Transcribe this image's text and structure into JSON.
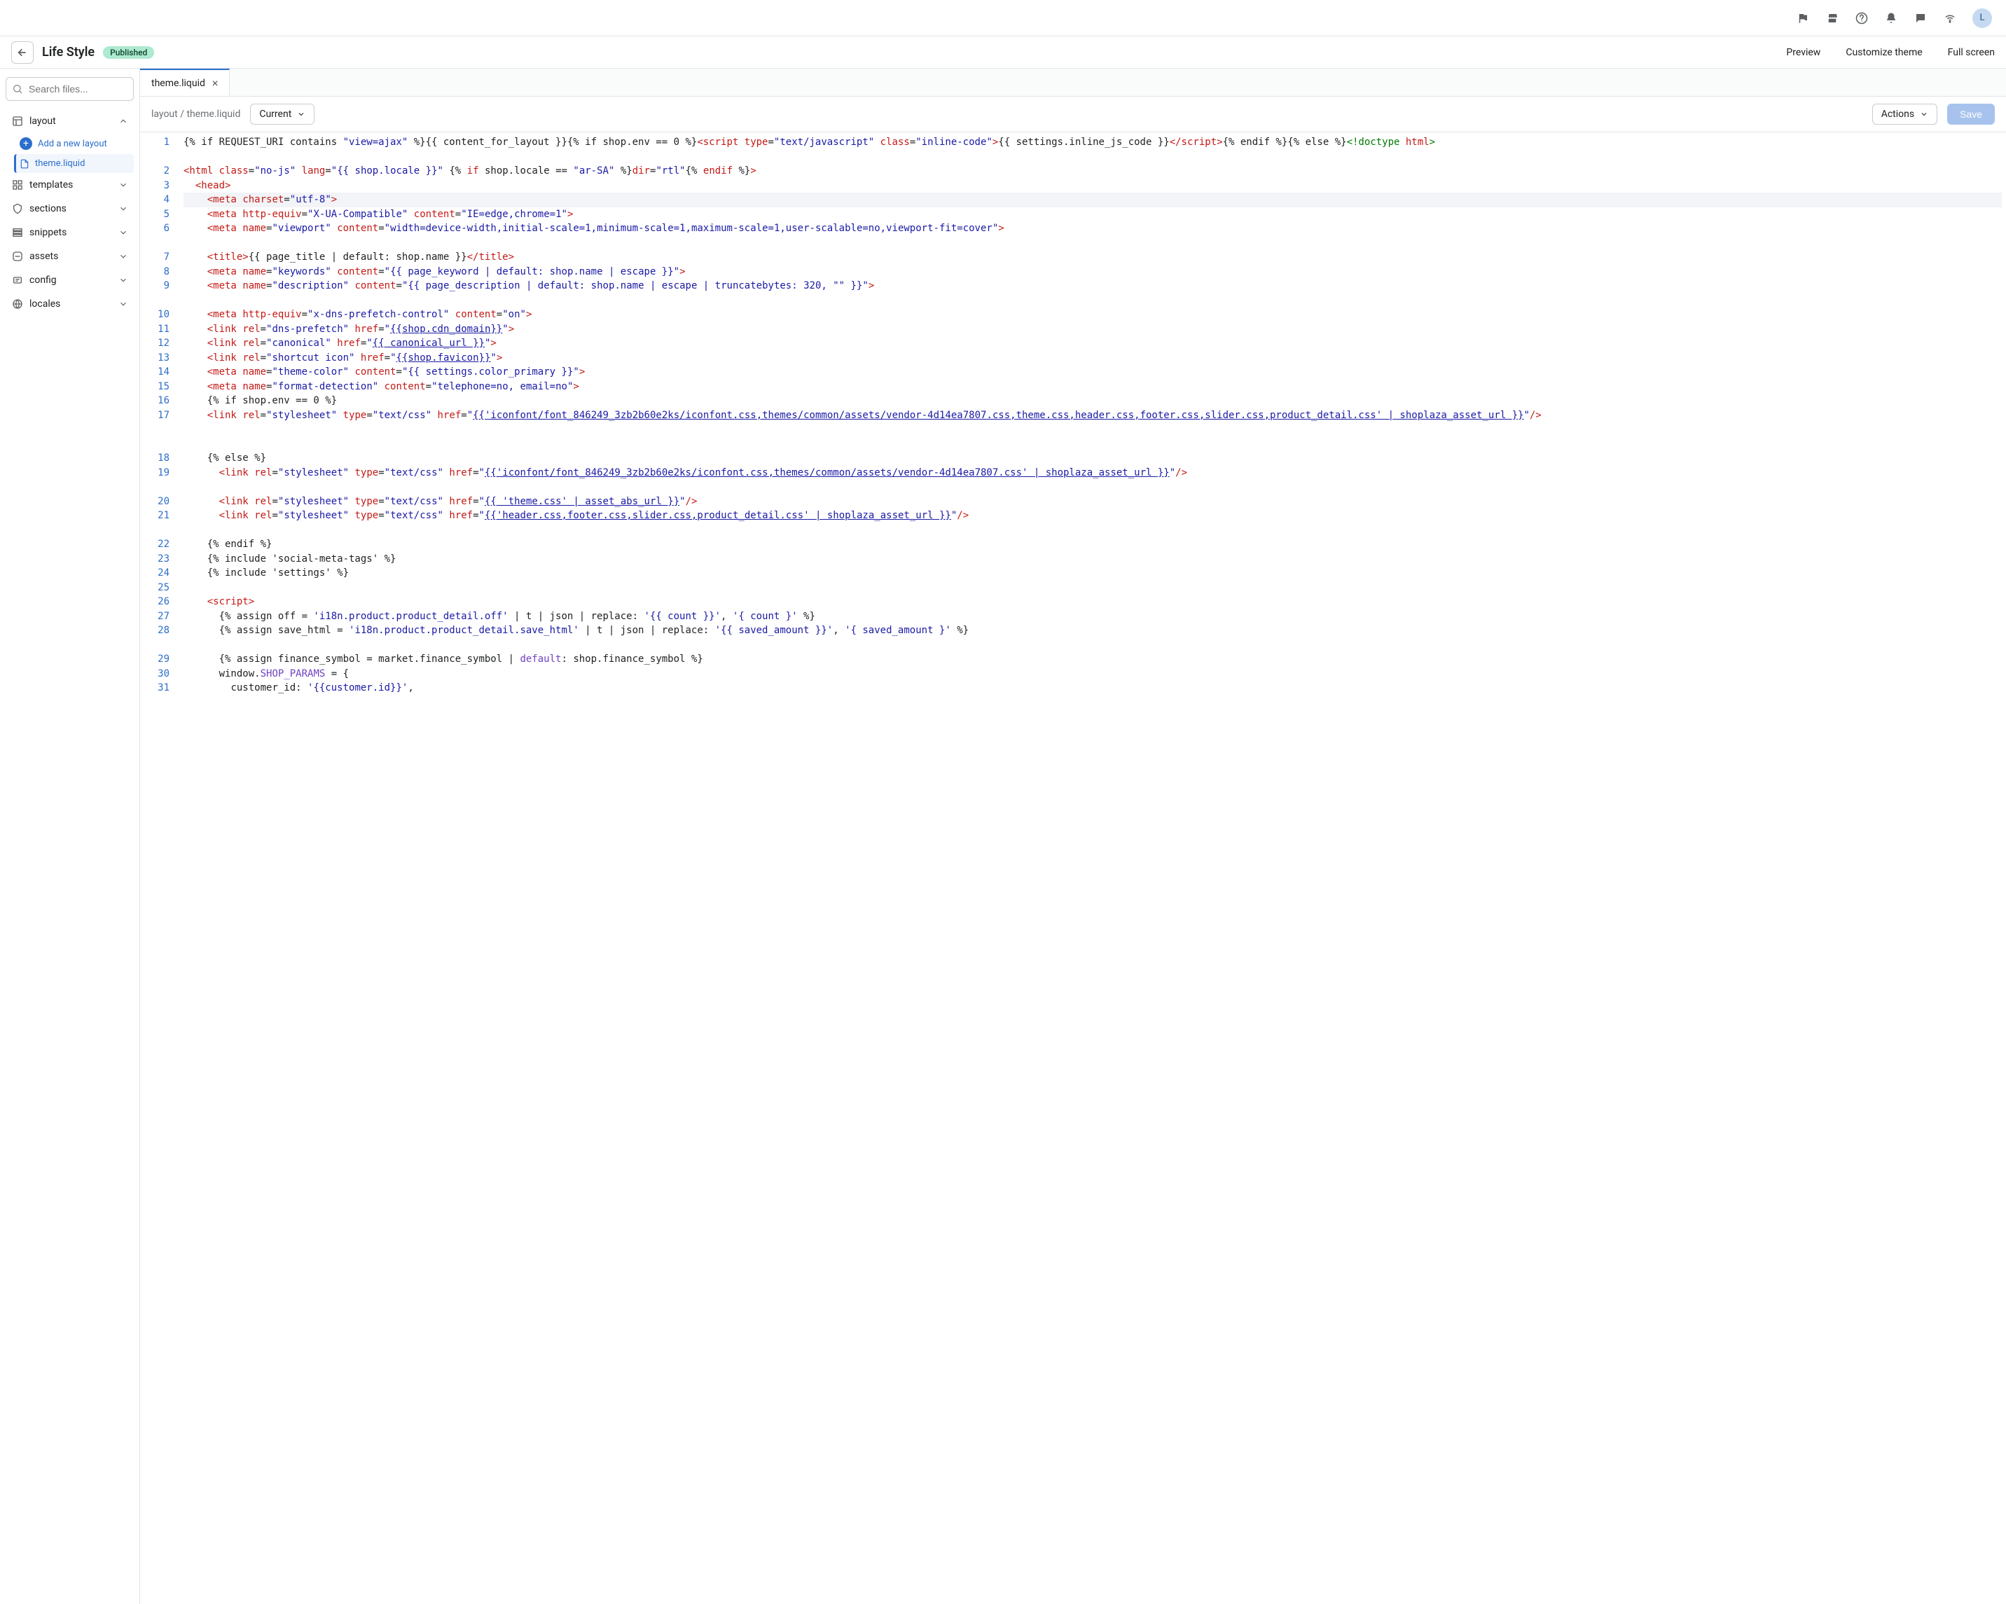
{
  "topbar": {
    "avatar_initial": "L"
  },
  "header": {
    "title": "Life Style",
    "badge": "Published",
    "preview": "Preview",
    "customize": "Customize theme",
    "fullscreen": "Full screen"
  },
  "sidebar": {
    "search_placeholder": "Search files...",
    "sections": [
      {
        "label": "layout",
        "expanded": true
      },
      {
        "label": "templates",
        "expanded": false
      },
      {
        "label": "sections",
        "expanded": false
      },
      {
        "label": "snippets",
        "expanded": false
      },
      {
        "label": "assets",
        "expanded": false
      },
      {
        "label": "config",
        "expanded": false
      },
      {
        "label": "locales",
        "expanded": false
      }
    ],
    "add_layout": "Add a new layout",
    "active_file": "theme.liquid"
  },
  "tabs": {
    "active": "theme.liquid"
  },
  "toolbar": {
    "breadcrumb": "layout / theme.liquid",
    "version": "Current",
    "actions": "Actions",
    "save": "Save"
  },
  "code": {
    "lines": [
      {
        "n": 1,
        "wrap": 2,
        "html": "{% if REQUEST_URI contains <span class='t-str'>\"view=ajax\"</span> %}{{ content_for_layout }}{% if shop.env == 0 %}<span class='t-tag'>&lt;script</span> <span class='t-attr'>type</span>=<span class='t-str'>\"text/javascript\"</span> <span class='t-attr'>class</span>=<span class='t-str'>\"inline-code\"</span><span class='t-tag'>&gt;</span>{{ settings.inline_js_code }}<span class='t-tag'>&lt;/script&gt;</span>{% endif %}{% else %}<span class='t-green'>&lt;!doctype</span> <span class='t-attr'>html</span><span class='t-green'>&gt;</span>"
      },
      {
        "n": 2,
        "wrap": 1,
        "html": "<span class='t-tag'>&lt;html</span> <span class='t-attr'>class</span>=<span class='t-str'>\"no-js\"</span> <span class='t-attr'>lang</span>=<span class='t-str'>\"{{ shop.locale }}\"</span> {% <span class='t-kw'>if</span> shop.locale == <span class='t-str'>\"ar-SA\"</span> %}<span class='t-attr'>dir</span>=<span class='t-str'>\"rtl\"</span>{% <span class='t-kw'>endif</span> %}<span class='t-tag'>&gt;</span>"
      },
      {
        "n": 3,
        "wrap": 1,
        "html": "  <span class='t-tag'>&lt;head&gt;</span>"
      },
      {
        "n": 4,
        "wrap": 1,
        "active": true,
        "html": "    <span class='t-tag'>&lt;meta</span> <span class='t-attr'>charset</span>=<span class='t-str'>\"utf-8\"</span><span class='t-tag'>&gt;</span>"
      },
      {
        "n": 5,
        "wrap": 1,
        "html": "    <span class='t-tag'>&lt;meta</span> <span class='t-attr'>http-equiv</span>=<span class='t-str'>\"X-UA-Compatible\"</span> <span class='t-attr'>content</span>=<span class='t-str'>\"IE=edge,chrome=1\"</span><span class='t-tag'>&gt;</span>"
      },
      {
        "n": 6,
        "wrap": 2,
        "html": "    <span class='t-tag'>&lt;meta</span> <span class='t-attr'>name</span>=<span class='t-str'>\"viewport\"</span> <span class='t-attr'>content</span>=<span class='t-str'>\"width=device-width,initial-scale=1,minimum-scale=1,maximum-scale=1,user-scalable=no,viewport-fit=cover\"</span><span class='t-tag'>&gt;</span>"
      },
      {
        "n": 7,
        "wrap": 1,
        "html": "    <span class='t-tag'>&lt;title&gt;</span>{{ page_title | default: shop.name }}<span class='t-tag'>&lt;/title&gt;</span>"
      },
      {
        "n": 8,
        "wrap": 1,
        "html": "    <span class='t-tag'>&lt;meta</span> <span class='t-attr'>name</span>=<span class='t-str'>\"keywords\"</span> <span class='t-attr'>content</span>=<span class='t-str'>\"{{ page_keyword | default: shop.name | escape }}\"</span><span class='t-tag'>&gt;</span>"
      },
      {
        "n": 9,
        "wrap": 2,
        "html": "    <span class='t-tag'>&lt;meta</span> <span class='t-attr'>name</span>=<span class='t-str'>\"description\"</span> <span class='t-attr'>content</span>=<span class='t-str'>\"{{ page_description | default: shop.name | escape | truncatebytes: 320, \"\" }}\"</span><span class='t-tag'>&gt;</span>"
      },
      {
        "n": 10,
        "wrap": 1,
        "html": "    <span class='t-tag'>&lt;meta</span> <span class='t-attr'>http-equiv</span>=<span class='t-str'>\"x-dns-prefetch-control\"</span> <span class='t-attr'>content</span>=<span class='t-str'>\"on\"</span><span class='t-tag'>&gt;</span>"
      },
      {
        "n": 11,
        "wrap": 1,
        "html": "    <span class='t-tag'>&lt;link</span> <span class='t-attr'>rel</span>=<span class='t-str'>\"dns-prefetch\"</span> <span class='t-attr'>href</span>=<span class='t-str'>\"<span class='t-underline'>{{shop.cdn_domain}}</span>\"</span><span class='t-tag'>&gt;</span>"
      },
      {
        "n": 12,
        "wrap": 1,
        "html": "    <span class='t-tag'>&lt;link</span> <span class='t-attr'>rel</span>=<span class='t-str'>\"canonical\"</span> <span class='t-attr'>href</span>=<span class='t-str'>\"<span class='t-underline'>{{ canonical_url }}</span>\"</span><span class='t-tag'>&gt;</span>"
      },
      {
        "n": 13,
        "wrap": 1,
        "html": "    <span class='t-tag'>&lt;link</span> <span class='t-attr'>rel</span>=<span class='t-str'>\"shortcut icon\"</span> <span class='t-attr'>href</span>=<span class='t-str'>\"<span class='t-underline'>{{shop.favicon}}</span>\"</span><span class='t-tag'>&gt;</span>"
      },
      {
        "n": 14,
        "wrap": 1,
        "html": "    <span class='t-tag'>&lt;meta</span> <span class='t-attr'>name</span>=<span class='t-str'>\"theme-color\"</span> <span class='t-attr'>content</span>=<span class='t-str'>\"{{ settings.color_primary }}\"</span><span class='t-tag'>&gt;</span>"
      },
      {
        "n": 15,
        "wrap": 1,
        "html": "    <span class='t-tag'>&lt;meta</span> <span class='t-attr'>name</span>=<span class='t-str'>\"format-detection\"</span> <span class='t-attr'>content</span>=<span class='t-str'>\"telephone=no, email=no\"</span><span class='t-tag'>&gt;</span>"
      },
      {
        "n": 16,
        "wrap": 1,
        "html": "    {% if shop.env == 0 %}"
      },
      {
        "n": 17,
        "wrap": 3,
        "html": "    <span class='t-tag'>&lt;link</span> <span class='t-attr'>rel</span>=<span class='t-str'>\"stylesheet\"</span> <span class='t-attr'>type</span>=<span class='t-str'>\"text/css\"</span> <span class='t-attr'>href</span>=<span class='t-str'>\"<span class='t-underline'>{{'iconfont/font_846249_3zb2b60e2ks/iconfont.css,themes/common/assets/vendor-4d14ea7807.css,theme.css,header.css,footer.css,slider.css,product_detail.css' | shoplaza_asset_url }}</span>\"</span><span class='t-tag'>/&gt;</span>"
      },
      {
        "n": 18,
        "wrap": 1,
        "html": "    {% else %}"
      },
      {
        "n": 19,
        "wrap": 2,
        "html": "      <span class='t-tag'>&lt;link</span> <span class='t-attr'>rel</span>=<span class='t-str'>\"stylesheet\"</span> <span class='t-attr'>type</span>=<span class='t-str'>\"text/css\"</span> <span class='t-attr'>href</span>=<span class='t-str'>\"<span class='t-underline'>{{'iconfont/font_846249_3zb2b60e2ks/iconfont.css,themes/common/assets/vendor-4d14ea7807.css' | shoplaza_asset_url }}</span>\"</span><span class='t-tag'>/&gt;</span>"
      },
      {
        "n": 20,
        "wrap": 1,
        "html": "      <span class='t-tag'>&lt;link</span> <span class='t-attr'>rel</span>=<span class='t-str'>\"stylesheet\"</span> <span class='t-attr'>type</span>=<span class='t-str'>\"text/css\"</span> <span class='t-attr'>href</span>=<span class='t-str'>\"<span class='t-underline'>{{ 'theme.css' | asset_abs_url }}</span>\"</span><span class='t-tag'>/&gt;</span>"
      },
      {
        "n": 21,
        "wrap": 2,
        "html": "      <span class='t-tag'>&lt;link</span> <span class='t-attr'>rel</span>=<span class='t-str'>\"stylesheet\"</span> <span class='t-attr'>type</span>=<span class='t-str'>\"text/css\"</span> <span class='t-attr'>href</span>=<span class='t-str'>\"<span class='t-underline'>{{'header.css,footer.css,slider.css,product_detail.css' | shoplaza_asset_url }}</span>\"</span><span class='t-tag'>/&gt;</span>"
      },
      {
        "n": 22,
        "wrap": 1,
        "html": "    {% endif %}"
      },
      {
        "n": 23,
        "wrap": 1,
        "html": "    {% include 'social-meta-tags' %}"
      },
      {
        "n": 24,
        "wrap": 1,
        "html": "    {% include 'settings' %}"
      },
      {
        "n": 25,
        "wrap": 1,
        "html": ""
      },
      {
        "n": 26,
        "wrap": 1,
        "html": "    <span class='t-tag'>&lt;script&gt;</span>"
      },
      {
        "n": 27,
        "wrap": 1,
        "html": "      {% assign off = <span class='t-str'>'i18n.product.product_detail.off'</span> | t | json | replace: <span class='t-str'>'{{ count }}'</span>, <span class='t-str'>'{ count }'</span> %}"
      },
      {
        "n": 28,
        "wrap": 2,
        "html": "      {% assign save_html = <span class='t-str'>'i18n.product.product_detail.save_html'</span> | t | json | replace: <span class='t-str'>'{{ saved_amount }}'</span>, <span class='t-str'>'{ saved_amount }'</span> %}"
      },
      {
        "n": 29,
        "wrap": 1,
        "html": "      {% assign finance_symbol = market.finance_symbol | <span class='t-purple'>default</span>: shop.finance_symbol %}"
      },
      {
        "n": 30,
        "wrap": 1,
        "html": "      window.<span class='t-purple'>SHOP_PARAMS</span> = {"
      },
      {
        "n": 31,
        "wrap": 1,
        "html": "        customer_id: <span class='t-str'>'{{customer.id}}'</span>,"
      }
    ]
  }
}
